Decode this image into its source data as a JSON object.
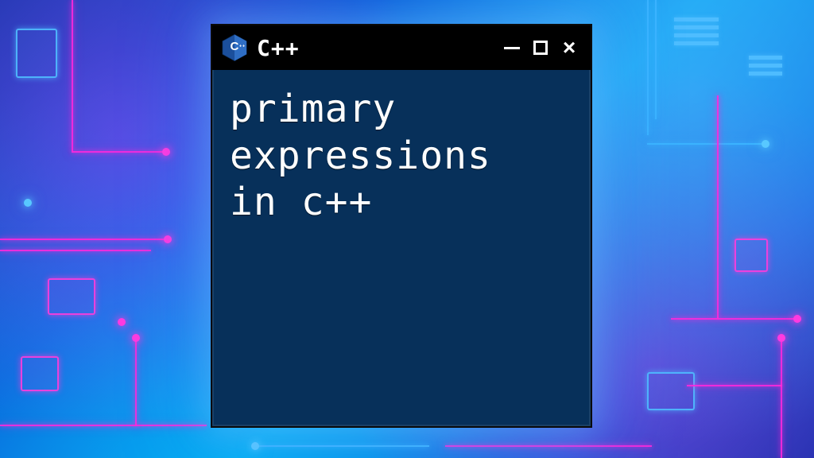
{
  "window": {
    "title": "C++",
    "icon": "cpp-logo-icon",
    "controls": {
      "minimize": "minimize-icon",
      "maximize": "maximize-icon",
      "close": "close-icon"
    }
  },
  "content": {
    "text": "primary\nexpressions\nin c++"
  },
  "theme": {
    "titlebar_bg": "#000000",
    "window_bg": "#07305a",
    "text_color": "#ffffff",
    "accent_pink": "#ff3ae0",
    "accent_blue": "#58c8ff"
  }
}
